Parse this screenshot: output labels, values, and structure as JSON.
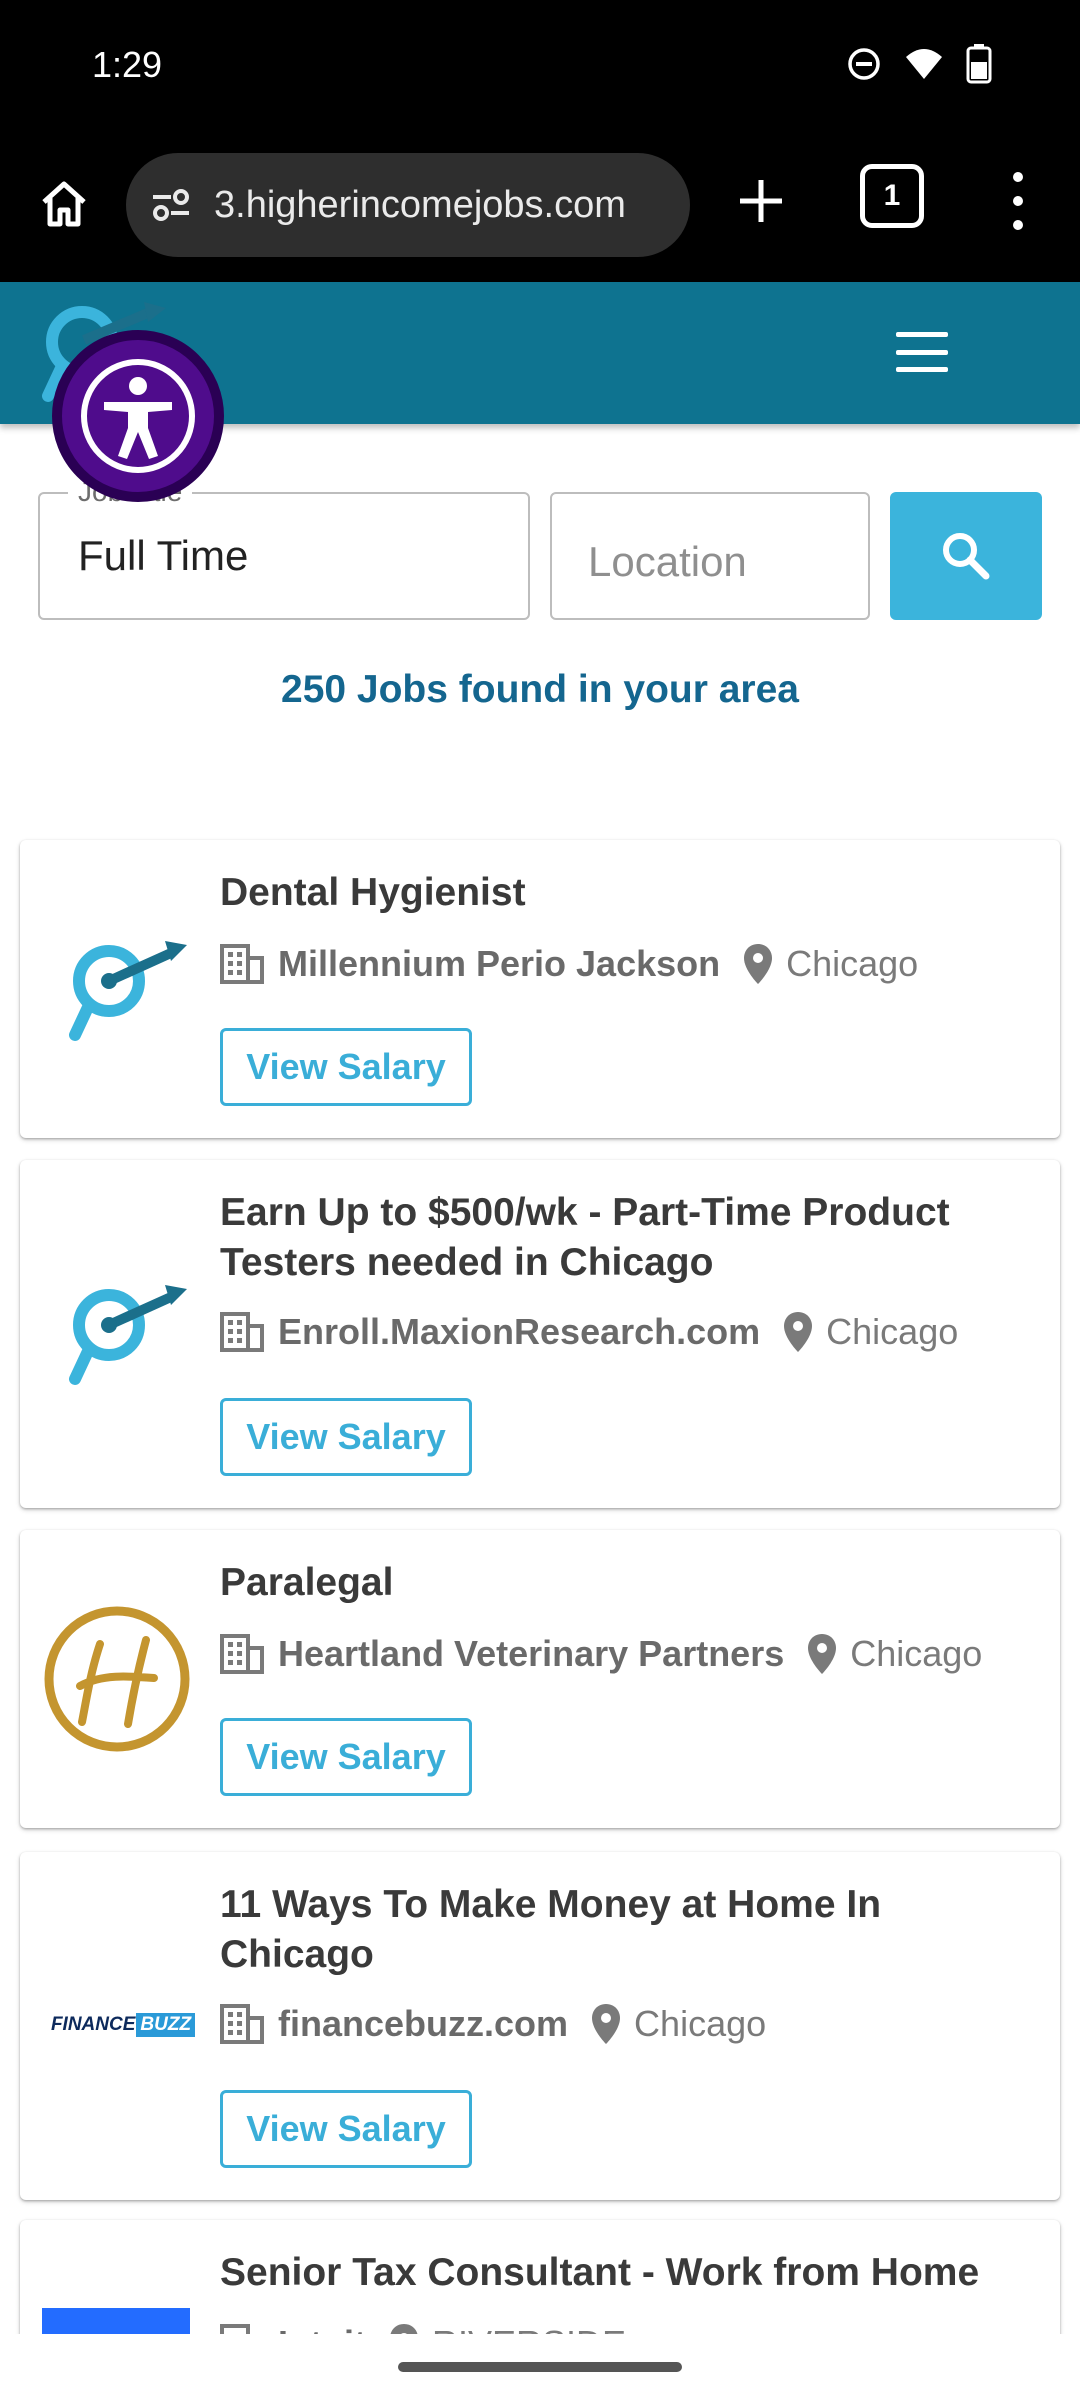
{
  "status_bar": {
    "time": "1:29"
  },
  "browser": {
    "url": "3.higherincomejobs.com",
    "tab_count": "1"
  },
  "search": {
    "job_title_legend": "Job Title",
    "job_title_value": "Full Time",
    "location_placeholder": "Location"
  },
  "results": {
    "count_text": "250 Jobs found in your area"
  },
  "jobs": [
    {
      "title": "Dental Hygienist",
      "company": "Millennium Perio Jackson",
      "city": "Chicago",
      "button": "View Salary",
      "logo": "target-magnifier-icon"
    },
    {
      "title": "Earn Up to $500/wk - Part-Time Product Testers needed in Chicago",
      "company": "Enroll.MaxionResearch.com",
      "city": "Chicago",
      "button": "View Salary",
      "logo": "target-magnifier-icon"
    },
    {
      "title": "Paralegal",
      "company": "Heartland Veterinary Partners",
      "city": "Chicago",
      "button": "View Salary",
      "logo": "heartland-h-logo"
    },
    {
      "title": "11 Ways To Make Money at Home In Chicago",
      "company": "financebuzz.com",
      "city": "Chicago",
      "button": "View Salary",
      "logo": "financebuzz-logo",
      "logo_text_a": "FINANCE",
      "logo_text_b": "BUZZ"
    },
    {
      "title": "Senior Tax Consultant - Work from Home",
      "company": "Intuit",
      "city": "RIVERSIDE",
      "logo": "intuit-logo"
    }
  ],
  "colors": {
    "header": "#0e7390",
    "accent": "#3bb4dc",
    "count_text": "#14668f",
    "a11y": "#4f0c8c"
  }
}
